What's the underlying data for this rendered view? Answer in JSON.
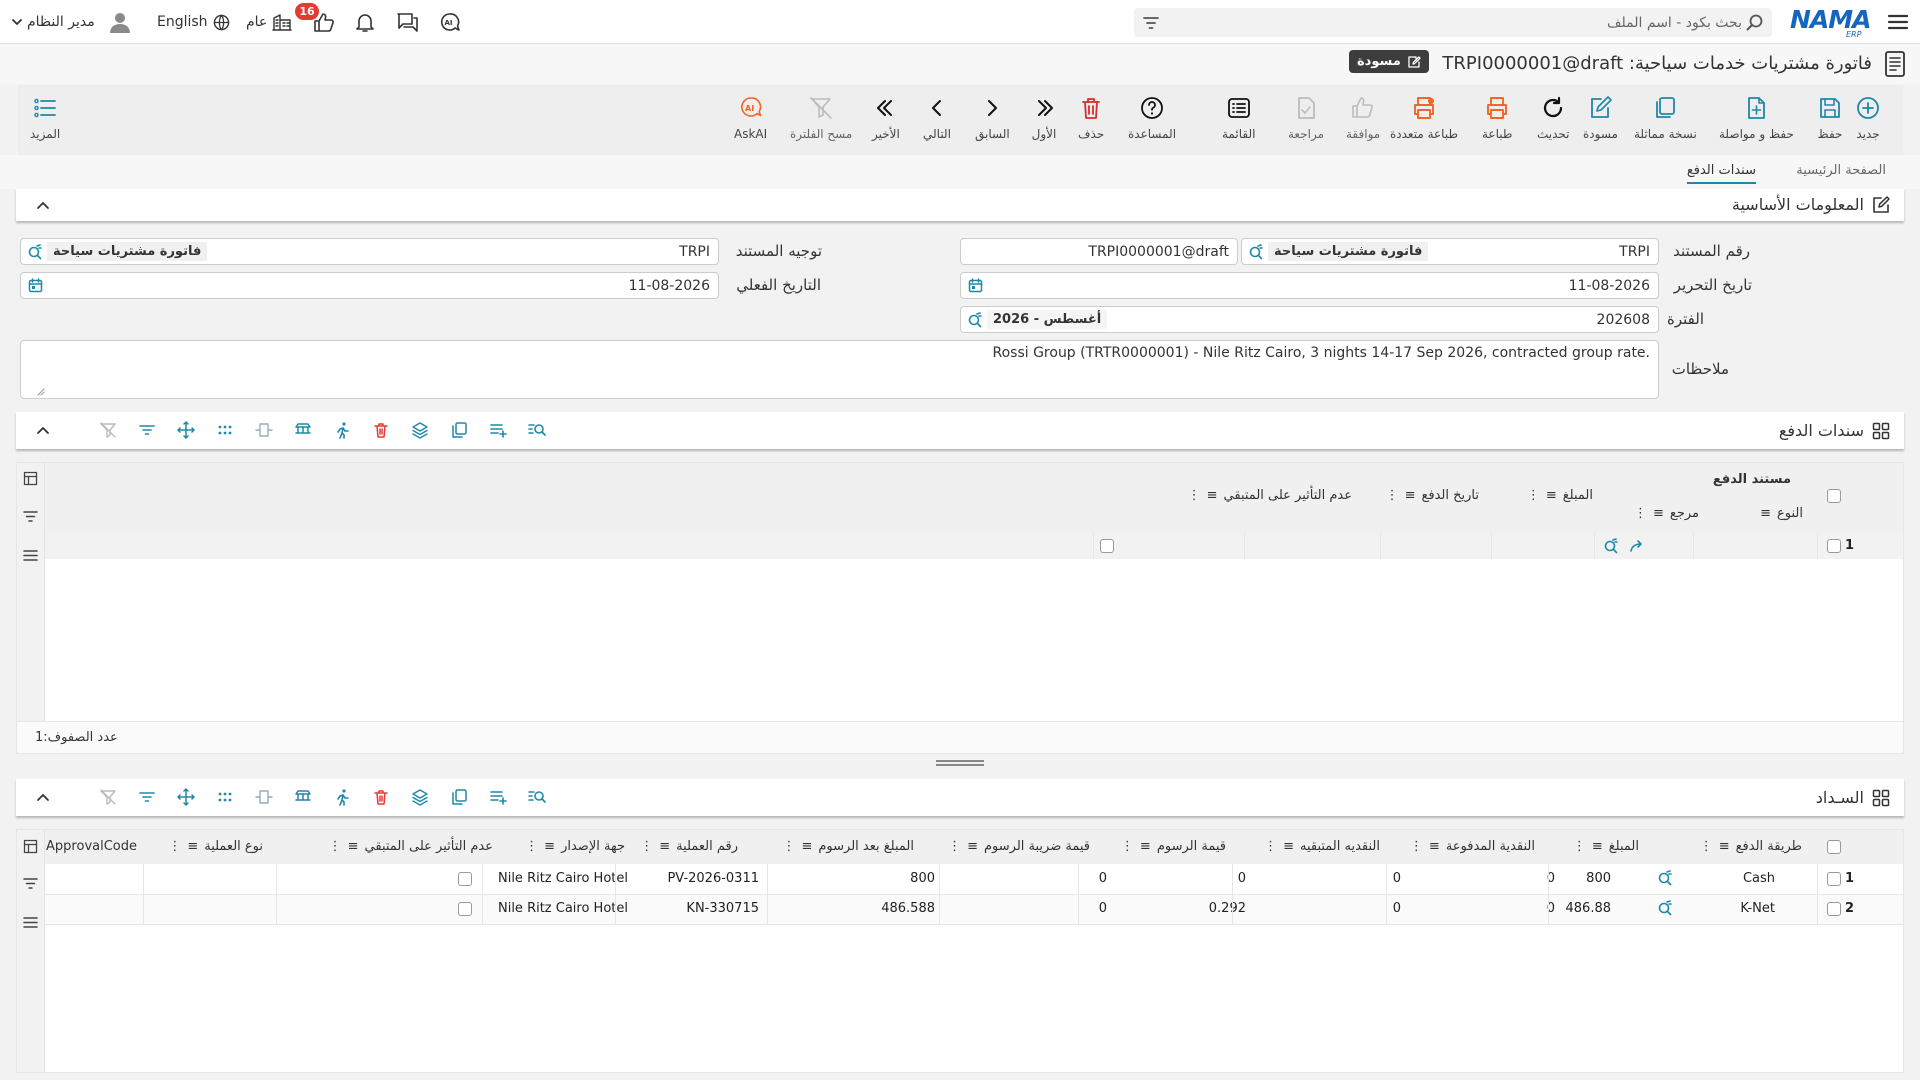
{
  "topbar": {
    "logo_text": "NAMA",
    "logo_sub": "ERP",
    "search_placeholder": "بحث بكود - اسم الملف",
    "user_name": "مدير النظام",
    "language": "English",
    "general": "عام",
    "notification_count": "16"
  },
  "header": {
    "title": "فاتورة مشتريات خدمات سياحية: TRPI0000001@draft",
    "status_badge": "مسودة"
  },
  "toolbar": {
    "items": [
      {
        "id": "new",
        "label": "جديد",
        "icon": "plus-circle-icon"
      },
      {
        "id": "save",
        "label": "حفظ",
        "icon": "save-icon"
      },
      {
        "id": "save_continue",
        "label": "حفظ و مواصلة",
        "icon": "file-plus-icon"
      },
      {
        "id": "duplicate",
        "label": "نسخة مماثلة",
        "icon": "copy-icon"
      },
      {
        "id": "draft",
        "label": "مسودة",
        "icon": "edit-icon"
      },
      {
        "id": "refresh",
        "label": "تحديث",
        "icon": "refresh-icon"
      },
      {
        "id": "print",
        "label": "طباعة",
        "icon": "printer-icon"
      },
      {
        "id": "multi_print",
        "label": "طباعة متعددة",
        "icon": "multi-printer-icon"
      },
      {
        "id": "approve",
        "label": "موافقة",
        "icon": "thumbs-up-icon"
      },
      {
        "id": "review",
        "label": "مراجعة",
        "icon": "review-icon"
      },
      {
        "id": "list",
        "label": "القائمة",
        "icon": "list-icon"
      },
      {
        "id": "help",
        "label": "المساعدة",
        "icon": "help-icon"
      },
      {
        "id": "delete",
        "label": "حذف",
        "icon": "trash-icon"
      },
      {
        "id": "first",
        "label": "الأول",
        "icon": "first-icon"
      },
      {
        "id": "prev",
        "label": "السابق",
        "icon": "prev-icon"
      },
      {
        "id": "next",
        "label": "التالي",
        "icon": "next-icon"
      },
      {
        "id": "last",
        "label": "الأخير",
        "icon": "last-icon"
      },
      {
        "id": "clear_filter",
        "label": "مسح الفلترة",
        "icon": "clear-filter-icon"
      },
      {
        "id": "askai",
        "label": "AskAI",
        "icon": "ai-icon"
      }
    ],
    "more": "المزيد"
  },
  "tabs": [
    {
      "label": "الصفحة الرئيسية",
      "active": false
    },
    {
      "label": "سندات الدفع",
      "active": true
    }
  ],
  "basic_info": {
    "title": "المعلومات الأساسية",
    "doc_number_label": "رقم المستند",
    "doc_number_code": "TRPI",
    "doc_number_type": "فاتورة مشتريات سياحة",
    "doc_number_value": "TRPI0000001@draft",
    "doc_direction_label": "توجيه المستند",
    "doc_direction_code": "TRPI",
    "doc_direction_type": "فاتورة مشتريات سياحة",
    "issue_date_label": "تاريخ التحرير",
    "issue_date": "11-08-2026",
    "actual_date_label": "التاريخ الفعلي",
    "actual_date": "11-08-2026",
    "period_label": "الفترة",
    "period_code": "202608",
    "period_name": "2026 - أغسطس",
    "notes_label": "ملاحظات",
    "notes": "Rossi Group (TRTR0000001) - Nile Ritz Cairo, 3 nights 14-17 Sep 2026, contracted group rate."
  },
  "payment_vouchers": {
    "title": "سندات الدفع",
    "group_header": "مستند الدفع",
    "columns": {
      "type": "النوع",
      "ref": "مرجع",
      "amount": "المبلغ",
      "pay_date": "تاريخ الدفع",
      "no_effect": "عدم التأثير على المتبقي"
    },
    "rows": [
      {
        "n": "1"
      }
    ],
    "row_count_label": "عدد الصفوف:",
    "row_count": "1"
  },
  "payment": {
    "title": "السـداد",
    "columns": {
      "method": "طريقة الدفع",
      "amount": "المبلغ",
      "paid_cash": "النقدية المدفوعة",
      "remaining_cash": "النقديه المتبقيه",
      "fees": "قيمة الرسوم",
      "fees_tax": "قيمة ضريبة الرسوم",
      "after_fees": "المبلغ بعد الرسوم",
      "op_number": "رقم العملية",
      "issuer": "جهة الإصدار",
      "no_effect": "عدم التأثير على المتبقي",
      "op_type": "نوع العملية",
      "approval": "ApprovalCode"
    },
    "rows": [
      {
        "n": "1",
        "method": "Cash",
        "amount": "800",
        "paid_cash": "0",
        "remaining_cash": "0",
        "fees": "0",
        "fees_tax": "0",
        "after_fees": "800",
        "op_number": "PV-2026-0311",
        "issuer": "Nile Ritz Cairo Hotel"
      },
      {
        "n": "2",
        "method": "K-Net",
        "amount": "486.88",
        "paid_cash": "0",
        "remaining_cash": "0",
        "fees": "0.292",
        "fees_tax": "0",
        "after_fees": "486.588",
        "op_number": "KN-330715",
        "issuer": "Nile Ritz Cairo Hotel"
      }
    ]
  },
  "colors": {
    "accent": "#1e88a8",
    "danger": "#e53935",
    "orange": "#f26522",
    "logo": "#1565c0"
  }
}
